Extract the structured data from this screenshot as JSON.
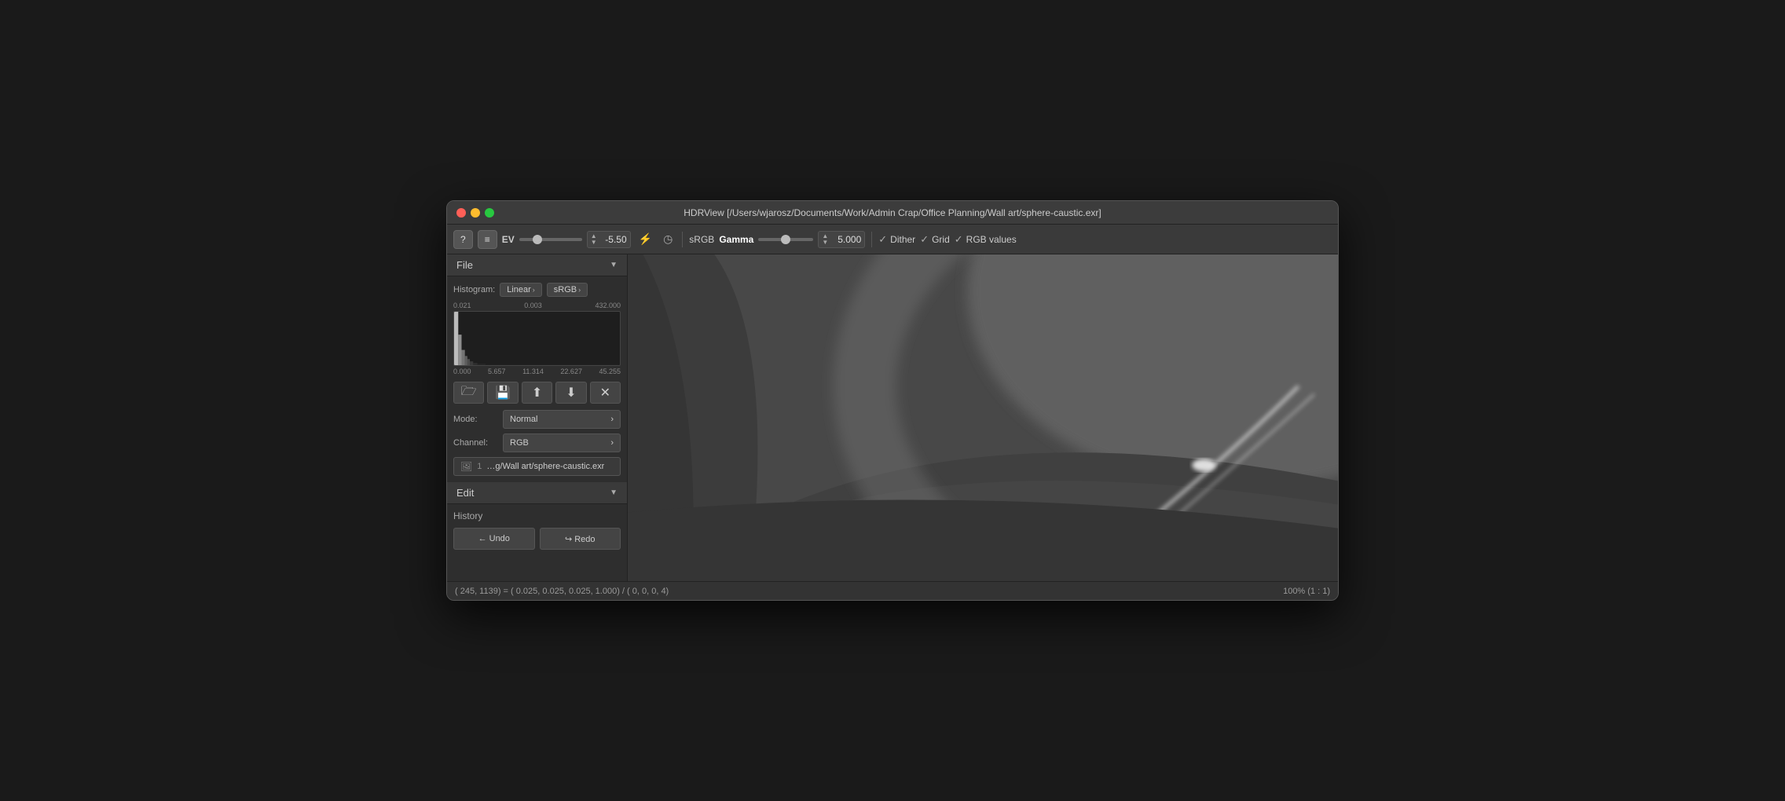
{
  "window": {
    "title": "HDRView [/Users/wjarosz/Documents/Work/Admin Crap/Office Planning/Wall art/sphere-caustic.exr]"
  },
  "toolbar": {
    "help_label": "?",
    "menu_label": "≡",
    "ev_label": "EV",
    "ev_value": "-5.50",
    "flash_icon": "⚡",
    "clock_icon": "◷",
    "srgb_label": "sRGB",
    "gamma_label": "Gamma",
    "gamma_value": "5.000",
    "dither_label": "Dither",
    "grid_label": "Grid",
    "rgb_values_label": "RGB values"
  },
  "sidebar": {
    "file_section": {
      "header": "File",
      "histogram_label": "Histogram:",
      "linear_btn": "Linear",
      "srgb_btn": "sRGB",
      "hist_top_labels": [
        "0.021",
        "0.003",
        "432.000"
      ],
      "hist_bottom_labels": [
        "0.000",
        "5.657",
        "11.314",
        "22.627",
        "45.255"
      ],
      "open_icon": "📁",
      "save_icon": "💾",
      "upload_icon": "⬆",
      "download_icon": "⬇",
      "close_icon": "✕",
      "mode_label": "Mode:",
      "mode_value": "Normal",
      "channel_label": "Channel:",
      "channel_value": "RGB",
      "file_num": "1",
      "file_name": "…g/Wall art/sphere-caustic.exr"
    },
    "edit_section": {
      "header": "Edit"
    },
    "history": {
      "title": "History",
      "undo_label": "← Undo",
      "redo_label": "↪ Redo"
    }
  },
  "status_bar": {
    "left": "( 245, 1139) = ( 0.025,  0.025,  0.025,  1.000) / (  0,   0,   0,  4)",
    "right": "100% (1 : 1)"
  }
}
